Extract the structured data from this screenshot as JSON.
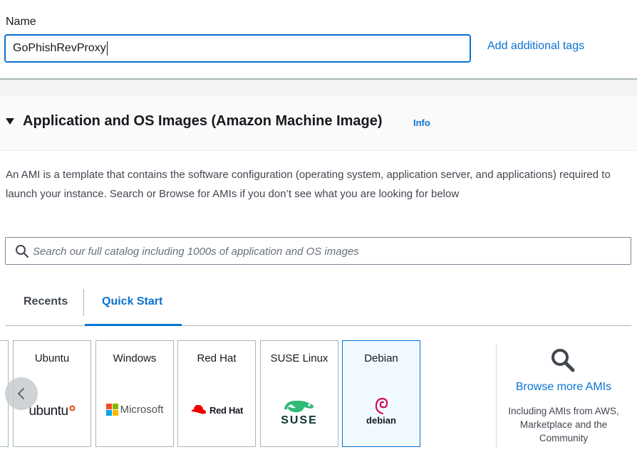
{
  "name_field": {
    "label": "Name",
    "value": "GoPhishRevProxy"
  },
  "add_tags_label": "Add additional tags",
  "section": {
    "title": "Application and OS Images (Amazon Machine Image)",
    "info_label": "Info"
  },
  "description": "An AMI is a template that contains the software configuration (operating system, application server, and applications) required to launch your instance. Search or Browse for AMIs if you don’t see what you are looking for below",
  "search": {
    "placeholder": "Search our full catalog including 1000s of application and OS images",
    "icon": "search-icon"
  },
  "tabs": [
    {
      "label": "Recents",
      "active": false
    },
    {
      "label": "Quick Start",
      "active": true
    }
  ],
  "ami_cards": [
    {
      "name": "Ubuntu",
      "logo_text": "ubuntu",
      "icon": "ubuntu-logo",
      "selected": false
    },
    {
      "name": "Windows",
      "logo_text": "Microsoft",
      "icon": "microsoft-logo",
      "selected": false
    },
    {
      "name": "Red Hat",
      "logo_text": "Red Hat",
      "icon": "redhat-logo",
      "selected": false
    },
    {
      "name": "SUSE Linux",
      "logo_text": "SUSE",
      "icon": "suse-logo",
      "selected": false
    },
    {
      "name": "Debian",
      "logo_text": "debian",
      "icon": "debian-logo",
      "selected": true
    }
  ],
  "browse": {
    "link_label": "Browse more AMIs",
    "subtext": "Including AMIs from AWS, Marketplace and the Community",
    "icon": "magnifier-icon"
  },
  "colors": {
    "accent": "#0972d3",
    "selected_bg": "#f1faff",
    "border": "#aab7b8"
  }
}
